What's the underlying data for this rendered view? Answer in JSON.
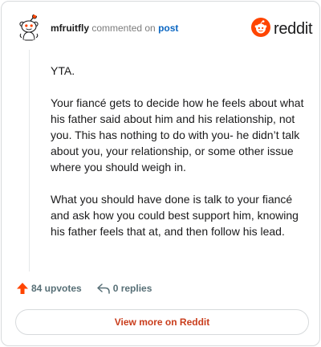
{
  "comment": {
    "username": "mfruitfly",
    "action_text": "commented on",
    "post_link_label": "post",
    "paragraphs": [
      "YTA.",
      "Your fiancé gets to decide how he feels about what his father said about him and his relationship, not you. This has nothing to do with you- he didn’t talk about you, your relationship, or some other issue where you should weigh in.",
      "What you should have done is talk to your fiancé and ask how you could best support him, knowing his father feels that at, and then follow his lead."
    ],
    "upvotes_label": "84 upvotes",
    "replies_label": "0 replies"
  },
  "brand": {
    "logo_text": "reddit",
    "accent_color": "#ff4500"
  },
  "actions": {
    "view_more_label": "View more on Reddit"
  },
  "icons": [
    "avatar-snoo",
    "reddit-logo-icon",
    "upvote-icon",
    "reply-icon"
  ]
}
